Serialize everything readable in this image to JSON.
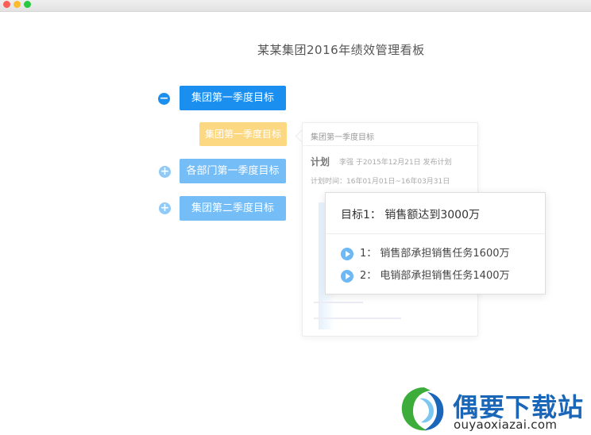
{
  "window": {
    "controls": [
      "close",
      "minimize",
      "maximize"
    ]
  },
  "page": {
    "title": "某某集团2016年绩效管理看板"
  },
  "tree": {
    "node1": {
      "label": "集团第一季度目标",
      "toggle": "−",
      "expanded": true
    },
    "node1_child": {
      "label": "集团第一季度目标"
    },
    "node2": {
      "label": "各部门第一季度目标",
      "toggle": "+",
      "expanded": false
    },
    "node3": {
      "label": "集团第二季度目标",
      "toggle": "+",
      "expanded": false
    }
  },
  "detail_panel": {
    "header": "集团第一季度目标",
    "plan_label": "计划",
    "plan_meta": "李强  于2015年12月21日  发布计划",
    "plan_time": "计划时间：16年01月01日~16年03月31日"
  },
  "goal_card": {
    "goal": "目标1：  销售额达到3000万",
    "items": [
      {
        "label": "1：  销售部承担销售任务1600万"
      },
      {
        "label": "2：  电销部承担销售任务1400万"
      }
    ]
  },
  "watermark": {
    "name": "偶要下载站",
    "url": "ouyaoxiazai.com",
    "colors": {
      "blue": "#1a66b8",
      "green": "#3cad3a"
    }
  },
  "colors": {
    "primary": "#1a8ff0",
    "light": "#75bdf7",
    "highlight": "#fcd883"
  }
}
